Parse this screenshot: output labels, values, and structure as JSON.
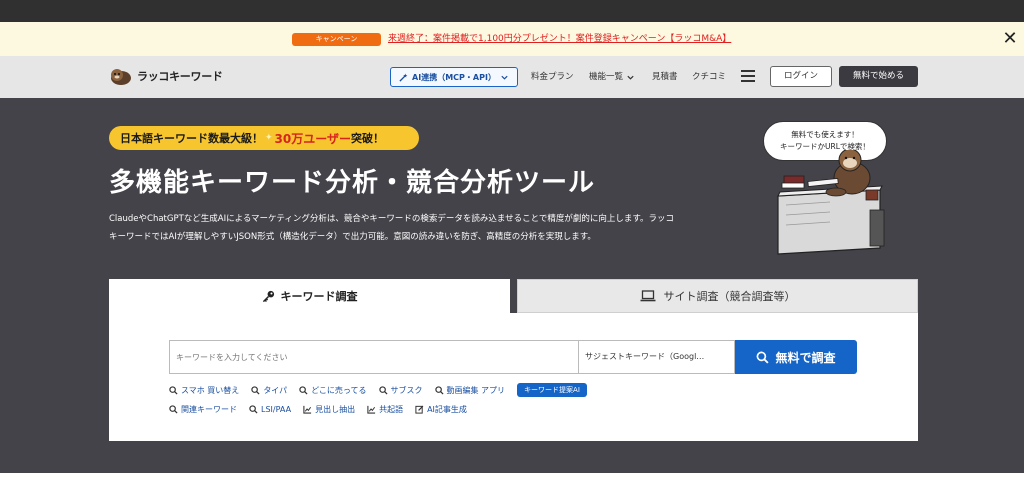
{
  "campaign": {
    "badge": "キャンペーン",
    "link": "来週終了：案件掲載で1,100円分プレゼント！案件登録キャンペーン【ラッコM&A】",
    "close_symbol": "✕"
  },
  "header": {
    "logo_text": "ラッコキーワード",
    "ai_button": "AI連携（MCP・API）",
    "nav": [
      "料金プラン",
      "機能一覧",
      "見積書",
      "クチコミ"
    ],
    "login": "ログイン",
    "signup": "無料で始める"
  },
  "hero": {
    "pill_part1": "日本語キーワード数最大級！",
    "pill_part2": "30万ユーザー",
    "pill_part3": "突破！",
    "title": "多機能キーワード分析・競合分析ツール",
    "desc_line1": "ClaudeやChatGPTなど生成AIによるマーケティング分析は、競合やキーワードの検索データを読み込ませることで精度が劇的に向上します。ラッコ",
    "desc_line2": "キーワードではAIが理解しやすいJSON形式（構造化データ）で出力可能。意図の読み違いを防ぎ、高精度の分析を実現します。",
    "speech_line1": "無料でも使えます！",
    "speech_line2": "キーワードかURLで検索！"
  },
  "tabs": {
    "keyword": "キーワード調査",
    "site": "サイト調査（競合調査等）"
  },
  "search": {
    "placeholder": "キーワードを入力してください",
    "select_value": "サジェストキーワード（Googl…",
    "button": "無料で調査"
  },
  "quick_links": {
    "row1": [
      "スマホ 買い替え",
      "タイパ",
      "どこに売ってる",
      "サブスク",
      "動画編集 アプリ"
    ],
    "badge": "キーワード提案AI",
    "row2": [
      "関連キーワード",
      "LSI/PAA",
      "見出し抽出",
      "共起語",
      "AI記事生成"
    ]
  },
  "icons": {
    "close": "close-icon",
    "magic": "magic-wand-icon",
    "chevron": "chevron-down-icon",
    "menu": "hamburger-icon",
    "key": "key-icon",
    "laptop": "laptop-icon",
    "search": "search-icon",
    "chart": "chart-icon",
    "edit": "edit-icon"
  },
  "colors": {
    "accent": "#1565c8",
    "campaign_bg": "#fdf8e0",
    "hero_bg": "#434349",
    "pill": "#f7c62f",
    "badge_orange": "#ef6c13"
  }
}
